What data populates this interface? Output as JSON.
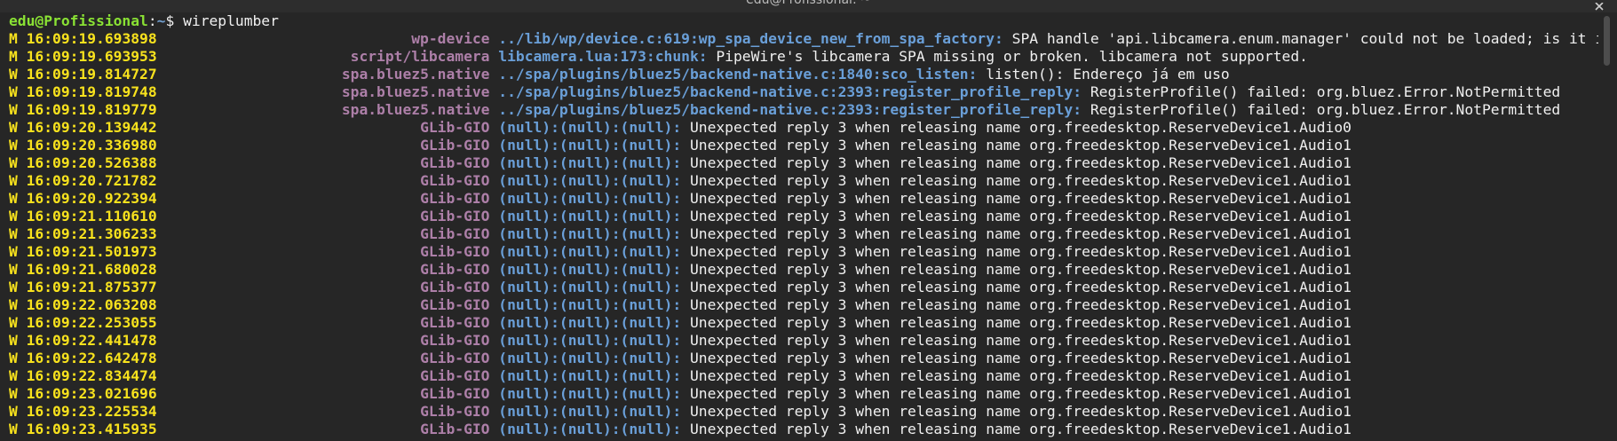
{
  "window": {
    "title": "edu@Profissional: ~"
  },
  "prompt": {
    "user_host": "edu@Profissional",
    "separator": ":",
    "path": "~",
    "symbol": "$",
    "command": " wireplumber"
  },
  "log_lines": [
    {
      "level": "M",
      "time": "16:09:19.693898",
      "source": "wp-device",
      "location": "../lib/wp/device.c:619:wp_spa_device_new_from_spa_factory:",
      "message": "SPA handle 'api.libcamera.enum.manager' could not be loaded; is it installed?"
    },
    {
      "level": "M",
      "time": "16:09:19.693953",
      "source": "script/libcamera",
      "location": "libcamera.lua:173:chunk:",
      "message": "PipeWire's libcamera SPA missing or broken. libcamera not supported."
    },
    {
      "level": "W",
      "time": "16:09:19.814727",
      "source": "spa.bluez5.native",
      "location": "../spa/plugins/bluez5/backend-native.c:1840:sco_listen:",
      "message": "listen(): Endereço já em uso"
    },
    {
      "level": "W",
      "time": "16:09:19.819748",
      "source": "spa.bluez5.native",
      "location": "../spa/plugins/bluez5/backend-native.c:2393:register_profile_reply:",
      "message": "RegisterProfile() failed: org.bluez.Error.NotPermitted"
    },
    {
      "level": "W",
      "time": "16:09:19.819779",
      "source": "spa.bluez5.native",
      "location": "../spa/plugins/bluez5/backend-native.c:2393:register_profile_reply:",
      "message": "RegisterProfile() failed: org.bluez.Error.NotPermitted"
    },
    {
      "level": "W",
      "time": "16:09:20.139442",
      "source": "GLib-GIO",
      "location": "(null):(null):(null):",
      "message": "Unexpected reply 3 when releasing name org.freedesktop.ReserveDevice1.Audio0"
    },
    {
      "level": "W",
      "time": "16:09:20.336980",
      "source": "GLib-GIO",
      "location": "(null):(null):(null):",
      "message": "Unexpected reply 3 when releasing name org.freedesktop.ReserveDevice1.Audio1"
    },
    {
      "level": "W",
      "time": "16:09:20.526388",
      "source": "GLib-GIO",
      "location": "(null):(null):(null):",
      "message": "Unexpected reply 3 when releasing name org.freedesktop.ReserveDevice1.Audio1"
    },
    {
      "level": "W",
      "time": "16:09:20.721782",
      "source": "GLib-GIO",
      "location": "(null):(null):(null):",
      "message": "Unexpected reply 3 when releasing name org.freedesktop.ReserveDevice1.Audio1"
    },
    {
      "level": "W",
      "time": "16:09:20.922394",
      "source": "GLib-GIO",
      "location": "(null):(null):(null):",
      "message": "Unexpected reply 3 when releasing name org.freedesktop.ReserveDevice1.Audio1"
    },
    {
      "level": "W",
      "time": "16:09:21.110610",
      "source": "GLib-GIO",
      "location": "(null):(null):(null):",
      "message": "Unexpected reply 3 when releasing name org.freedesktop.ReserveDevice1.Audio1"
    },
    {
      "level": "W",
      "time": "16:09:21.306233",
      "source": "GLib-GIO",
      "location": "(null):(null):(null):",
      "message": "Unexpected reply 3 when releasing name org.freedesktop.ReserveDevice1.Audio1"
    },
    {
      "level": "W",
      "time": "16:09:21.501973",
      "source": "GLib-GIO",
      "location": "(null):(null):(null):",
      "message": "Unexpected reply 3 when releasing name org.freedesktop.ReserveDevice1.Audio1"
    },
    {
      "level": "W",
      "time": "16:09:21.680028",
      "source": "GLib-GIO",
      "location": "(null):(null):(null):",
      "message": "Unexpected reply 3 when releasing name org.freedesktop.ReserveDevice1.Audio1"
    },
    {
      "level": "W",
      "time": "16:09:21.875377",
      "source": "GLib-GIO",
      "location": "(null):(null):(null):",
      "message": "Unexpected reply 3 when releasing name org.freedesktop.ReserveDevice1.Audio1"
    },
    {
      "level": "W",
      "time": "16:09:22.063208",
      "source": "GLib-GIO",
      "location": "(null):(null):(null):",
      "message": "Unexpected reply 3 when releasing name org.freedesktop.ReserveDevice1.Audio1"
    },
    {
      "level": "W",
      "time": "16:09:22.253055",
      "source": "GLib-GIO",
      "location": "(null):(null):(null):",
      "message": "Unexpected reply 3 when releasing name org.freedesktop.ReserveDevice1.Audio1"
    },
    {
      "level": "W",
      "time": "16:09:22.441478",
      "source": "GLib-GIO",
      "location": "(null):(null):(null):",
      "message": "Unexpected reply 3 when releasing name org.freedesktop.ReserveDevice1.Audio1"
    },
    {
      "level": "W",
      "time": "16:09:22.642478",
      "source": "GLib-GIO",
      "location": "(null):(null):(null):",
      "message": "Unexpected reply 3 when releasing name org.freedesktop.ReserveDevice1.Audio1"
    },
    {
      "level": "W",
      "time": "16:09:22.834474",
      "source": "GLib-GIO",
      "location": "(null):(null):(null):",
      "message": "Unexpected reply 3 when releasing name org.freedesktop.ReserveDevice1.Audio1"
    },
    {
      "level": "W",
      "time": "16:09:23.021696",
      "source": "GLib-GIO",
      "location": "(null):(null):(null):",
      "message": "Unexpected reply 3 when releasing name org.freedesktop.ReserveDevice1.Audio1"
    },
    {
      "level": "W",
      "time": "16:09:23.225534",
      "source": "GLib-GIO",
      "location": "(null):(null):(null):",
      "message": "Unexpected reply 3 when releasing name org.freedesktop.ReserveDevice1.Audio1"
    },
    {
      "level": "W",
      "time": "16:09:23.415935",
      "source": "GLib-GIO",
      "location": "(null):(null):(null):",
      "message": "Unexpected reply 3 when releasing name org.freedesktop.ReserveDevice1.Audio1"
    }
  ],
  "icons": {
    "close": "close-icon"
  },
  "colors": {
    "background": "#262626",
    "prompt_user": "#8ae234",
    "prompt_path": "#729fcf",
    "level_time": "#f8e21d",
    "source": "#ad7fa8",
    "location": "#6a9fd8",
    "message": "#f0f0f0"
  }
}
